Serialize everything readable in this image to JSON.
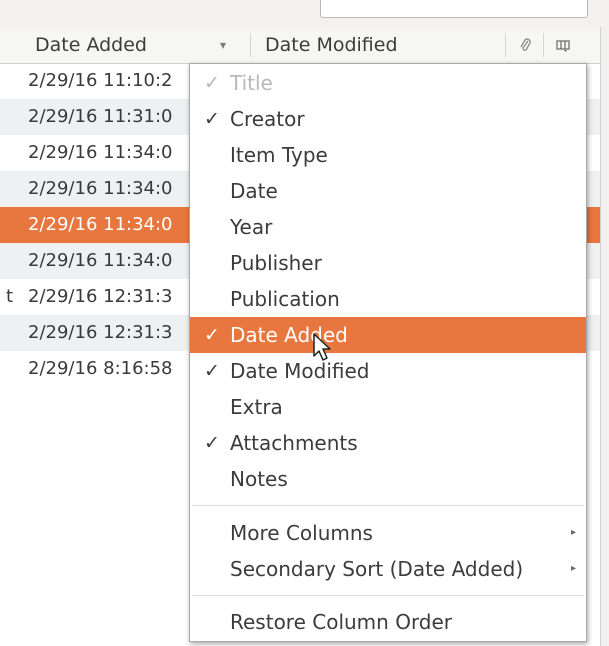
{
  "header": {
    "date_added": "Date Added",
    "sort_arrow": "▾",
    "date_modified": "Date Modified",
    "attachment_icon": "paperclip-icon",
    "column_picker_icon": "column-picker-icon"
  },
  "rows": [
    {
      "prefix": "",
      "date": "2/29/16 11:10:2"
    },
    {
      "prefix": "",
      "date": "2/29/16 11:31:0"
    },
    {
      "prefix": "",
      "date": "2/29/16 11:34:0"
    },
    {
      "prefix": "",
      "date": "2/29/16 11:34:0"
    },
    {
      "prefix": "",
      "date": "2/29/16 11:34:0"
    },
    {
      "prefix": "",
      "date": "2/29/16 11:34:0"
    },
    {
      "prefix": "t",
      "date": "2/29/16 12:31:3"
    },
    {
      "prefix": "",
      "date": "2/29/16 12:31:3"
    },
    {
      "prefix": "",
      "date": "2/29/16 8:16:58"
    }
  ],
  "menu": {
    "items": [
      {
        "label": "Title",
        "checked": true,
        "disabled": true
      },
      {
        "label": "Creator",
        "checked": true
      },
      {
        "label": "Item Type",
        "checked": false
      },
      {
        "label": "Date",
        "checked": false
      },
      {
        "label": "Year",
        "checked": false
      },
      {
        "label": "Publisher",
        "checked": false
      },
      {
        "label": "Publication",
        "checked": false
      },
      {
        "label": "Date Added",
        "checked": true,
        "highlighted": true
      },
      {
        "label": "Date Modified",
        "checked": true
      },
      {
        "label": "Extra",
        "checked": false
      },
      {
        "label": "Attachments",
        "checked": true
      },
      {
        "label": "Notes",
        "checked": false
      }
    ],
    "more_columns": "More Columns",
    "secondary_sort": "Secondary Sort (Date Added)",
    "restore_order": "Restore Column Order",
    "check_glyph": "✓",
    "submenu_arrow": "▸"
  },
  "colors": {
    "accent": "#e8773f",
    "row_alt": "#eef0f2"
  }
}
